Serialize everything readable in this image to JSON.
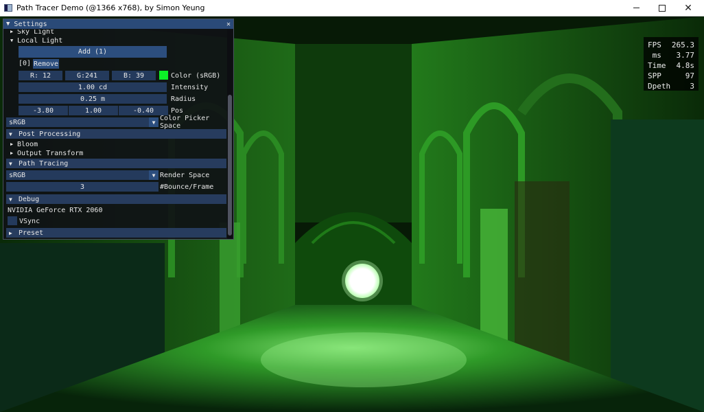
{
  "window": {
    "title": "Path Tracer Demo (@1366 x768), by Simon Yeung",
    "minimize_label": "—",
    "maximize_label": "",
    "close_label": "✕"
  },
  "stats": {
    "rows": [
      {
        "label": "FPS",
        "value": "265.3"
      },
      {
        "label": " ms",
        "value": "3.77"
      },
      {
        "label": "Time",
        "value": "4.8s"
      },
      {
        "label": "SPP",
        "value": "97"
      },
      {
        "label": "Dpeth",
        "value": "3"
      }
    ]
  },
  "settings": {
    "title": "Settings",
    "close_label": "✕",
    "sky_light": "Sky Light",
    "local_light": "Local Light",
    "add_label": "Add (1)",
    "item_index": "[0]",
    "remove_label": "Remove",
    "color": {
      "r": "R: 12",
      "g": "G:241",
      "b": "B: 39",
      "hex": "#0cf127",
      "label": "Color (sRGB)"
    },
    "intensity": {
      "value": "1.00 cd",
      "label": "Intensity"
    },
    "radius": {
      "value": "0.25 m",
      "label": "Radius"
    },
    "pos": {
      "x": "-3.80",
      "y": "1.00",
      "z": "-0.40",
      "label": "Pos"
    },
    "color_picker_space": {
      "value": "sRGB",
      "label": "Color Picker Space"
    },
    "post_processing": {
      "label": "Post Processing",
      "bloom": "Bloom",
      "output_transform": "Output Transform"
    },
    "path_tracing": {
      "label": "Path Tracing",
      "render_space_value": "sRGB",
      "render_space_label": "Render Space",
      "bounce_value": "3",
      "bounce_label": "#Bounce/Frame"
    },
    "debug": {
      "label": "Debug",
      "gpu": "NVIDIA GeForce RTX 2060",
      "vsync": "VSync"
    },
    "preset": {
      "label": "Preset"
    }
  }
}
